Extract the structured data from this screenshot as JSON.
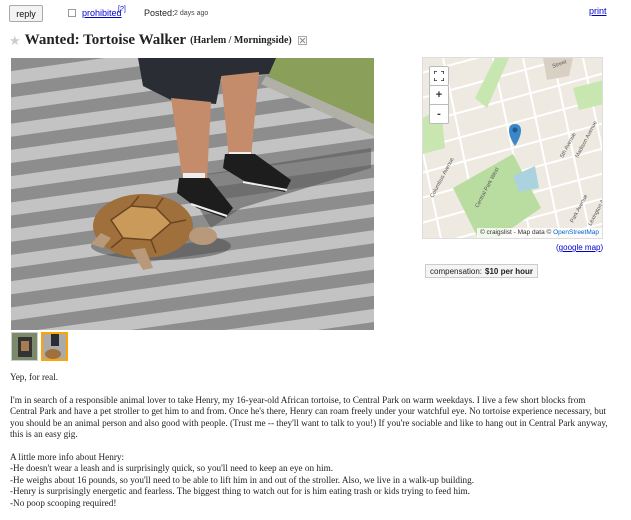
{
  "topbar": {
    "reply_label": "reply",
    "prohibited_label": "prohibited",
    "prohibited_help": "[?]",
    "posted_label": "Posted:",
    "posted_time": "2 days ago",
    "print_label": "print"
  },
  "posting": {
    "title": "Wanted: Tortoise Walker",
    "neighborhood": "(Harlem / Morningside)",
    "star_icon": "star-icon",
    "hide_icon": "hide-icon"
  },
  "map": {
    "attribution_prefix": "© craigslist - Map data ©",
    "attribution_osm": "OpenStreetMap",
    "google_map_open": "(",
    "google_map_label": "google map",
    "google_map_close": ")",
    "fullscreen_icon": "fullscreen-icon",
    "zoom_in": "+",
    "zoom_out": "-",
    "labels": {
      "columbus": "Columbus Avenue",
      "cpw": "Central Park West",
      "fifth": "5th Avenue",
      "madison": "Madison Avenue",
      "park": "Park Avenue",
      "lex": "Lexington Avenue",
      "street": "Street"
    }
  },
  "attributes": {
    "compensation_label": "compensation:",
    "compensation_value": "$10 per hour"
  },
  "body": {
    "p1": "Yep, for real.",
    "p2": "I'm in search of a responsible animal lover to take Henry, my 16-year-old African tortoise, to Central Park on warm weekdays. I live a few short blocks from Central Park and have a pet stroller to get him to and from. Once he's there, Henry can roam freely under your watchful eye. No tortoise experience necessary, but you should be an animal person and also good with people. (Trust me -- they'll want to talk to you!) If you're sociable and like to hang out in Central Park anyway, this is an easy gig.",
    "list_intro": "A little more info about Henry:",
    "items": [
      "-He doesn't wear a leash and is surprisingly quick, so you'll need to keep an eye on him.",
      "-He weighs about 16 pounds, so you'll need to be able to lift him in and out of the stroller. Also, we live in a walk-up building.",
      "-Henry is surprisingly energetic and fearless. The biggest thing to watch out for is him eating trash or kids trying to feed him.",
      "-No poop scooping required!"
    ]
  },
  "colors": {
    "link": "#0000cc",
    "park_green": "#b9dca0",
    "map_pin": "#3a86c8",
    "thumb_selected": "#ffa500"
  }
}
